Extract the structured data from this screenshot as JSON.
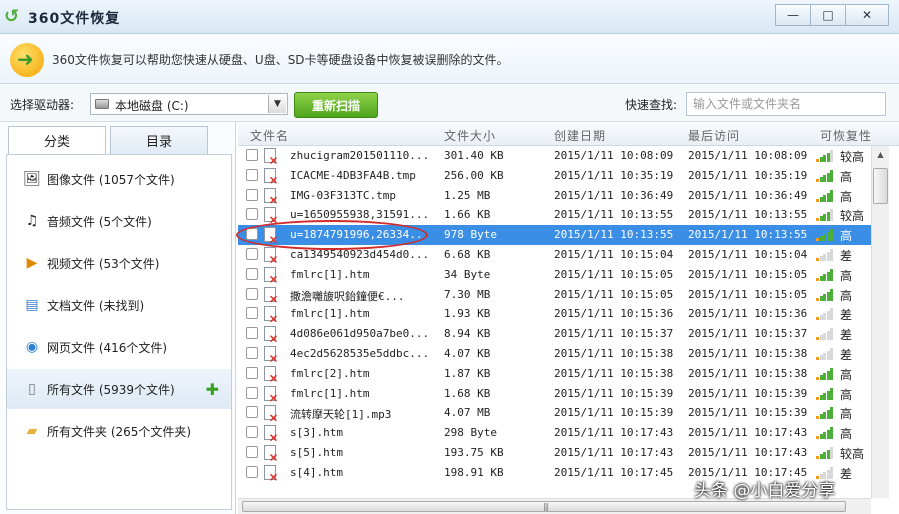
{
  "window": {
    "title": "360文件恢复",
    "controls": {
      "minimize": "—",
      "maximize": "□",
      "close": "✕"
    }
  },
  "info": {
    "text": "360文件恢复可以帮助您快速从硬盘、U盘、SD卡等硬盘设备中恢复被误删除的文件。"
  },
  "toolbar": {
    "drive_label": "选择驱动器:",
    "drive_value": "本地磁盘 (C:)",
    "rescan_label": "重新扫描",
    "quick_label": "快速查找:",
    "quick_placeholder": "输入文件或文件夹名"
  },
  "sidebar": {
    "tabs": [
      {
        "label": "分类"
      },
      {
        "label": "目录"
      }
    ],
    "categories": [
      {
        "label": "图像文件 (1057个文件)",
        "icon": "image-icon"
      },
      {
        "label": "音频文件 (5个文件)",
        "icon": "music-icon"
      },
      {
        "label": "视频文件 (53个文件)",
        "icon": "video-icon"
      },
      {
        "label": "文档文件 (未找到)",
        "icon": "document-icon"
      },
      {
        "label": "网页文件 (416个文件)",
        "icon": "web-icon"
      },
      {
        "label": "所有文件 (5939个文件)",
        "icon": "file-icon"
      },
      {
        "label": "所有文件夹 (265个文件夹)",
        "icon": "folder-icon"
      }
    ],
    "add_icon": "plus-icon"
  },
  "table": {
    "columns": [
      "文件名",
      "文件大小",
      "创建日期",
      "最后访问",
      "可恢复性"
    ],
    "rows": [
      {
        "name": "zhucigram201501110...",
        "size": "301.40 KB",
        "created": "2015/1/11 10:08:09",
        "accessed": "2015/1/11 10:08:09",
        "level": "较高",
        "bars": 4
      },
      {
        "name": "ICACME-4DB3FA4B.tmp",
        "size": "256.00 KB",
        "created": "2015/1/11 10:35:19",
        "accessed": "2015/1/11 10:35:19",
        "level": "高",
        "bars": 5
      },
      {
        "name": "IMG-03F313TC.tmp",
        "size": "1.25 MB",
        "created": "2015/1/11 10:36:49",
        "accessed": "2015/1/11 10:36:49",
        "level": "高",
        "bars": 5
      },
      {
        "name": "u=1650955938,31591...",
        "size": "1.66 KB",
        "created": "2015/1/11 10:13:55",
        "accessed": "2015/1/11 10:13:55",
        "level": "较高",
        "bars": 4
      },
      {
        "name": "u=1874791996,26334...",
        "size": "978 Byte",
        "created": "2015/1/11 10:13:55",
        "accessed": "2015/1/11 10:13:55",
        "level": "高",
        "bars": 5
      },
      {
        "name": "ca1349540923d454d0...",
        "size": "6.68 KB",
        "created": "2015/1/11 10:15:04",
        "accessed": "2015/1/11 10:15:04",
        "level": "差",
        "bars": 1
      },
      {
        "name": "fmlrc[1].htm",
        "size": "34 Byte",
        "created": "2015/1/11 10:15:05",
        "accessed": "2015/1/11 10:15:05",
        "level": "高",
        "bars": 5
      },
      {
        "name": "撒澹囄旇呎鈶鐘便€...",
        "size": "7.30 MB",
        "created": "2015/1/11 10:15:05",
        "accessed": "2015/1/11 10:15:05",
        "level": "高",
        "bars": 5
      },
      {
        "name": "fmlrc[1].htm",
        "size": "1.93 KB",
        "created": "2015/1/11 10:15:36",
        "accessed": "2015/1/11 10:15:36",
        "level": "差",
        "bars": 1
      },
      {
        "name": "4d086e061d950a7be0...",
        "size": "8.94 KB",
        "created": "2015/1/11 10:15:37",
        "accessed": "2015/1/11 10:15:37",
        "level": "差",
        "bars": 1
      },
      {
        "name": "4ec2d5628535e5ddbc...",
        "size": "4.07 KB",
        "created": "2015/1/11 10:15:38",
        "accessed": "2015/1/11 10:15:38",
        "level": "差",
        "bars": 1
      },
      {
        "name": "fmlrc[2].htm",
        "size": "1.87 KB",
        "created": "2015/1/11 10:15:38",
        "accessed": "2015/1/11 10:15:38",
        "level": "高",
        "bars": 5
      },
      {
        "name": "fmlrc[1].htm",
        "size": "1.68 KB",
        "created": "2015/1/11 10:15:39",
        "accessed": "2015/1/11 10:15:39",
        "level": "高",
        "bars": 5
      },
      {
        "name": "流转摩天轮[1].mp3",
        "size": "4.07 MB",
        "created": "2015/1/11 10:15:39",
        "accessed": "2015/1/11 10:15:39",
        "level": "高",
        "bars": 5
      },
      {
        "name": "s[3].htm",
        "size": "298 Byte",
        "created": "2015/1/11 10:17:43",
        "accessed": "2015/1/11 10:17:43",
        "level": "高",
        "bars": 5
      },
      {
        "name": "s[5].htm",
        "size": "193.75 KB",
        "created": "2015/1/11 10:17:43",
        "accessed": "2015/1/11 10:17:43",
        "level": "较高",
        "bars": 4
      },
      {
        "name": "s[4].htm",
        "size": "198.91 KB",
        "created": "2015/1/11 10:17:45",
        "accessed": "2015/1/11 10:17:45",
        "level": "差",
        "bars": 1
      }
    ],
    "selected_index": 4
  },
  "watermark": "头条 @小白爱分享",
  "colors": {
    "accent": "#3a8ee6",
    "rescan_green": "#4ea51c",
    "bar_green": "#4caf3a",
    "bar_orange": "#f29a1a",
    "bar_off": "#d8d8d8",
    "annotation_red": "#d22b2b"
  }
}
